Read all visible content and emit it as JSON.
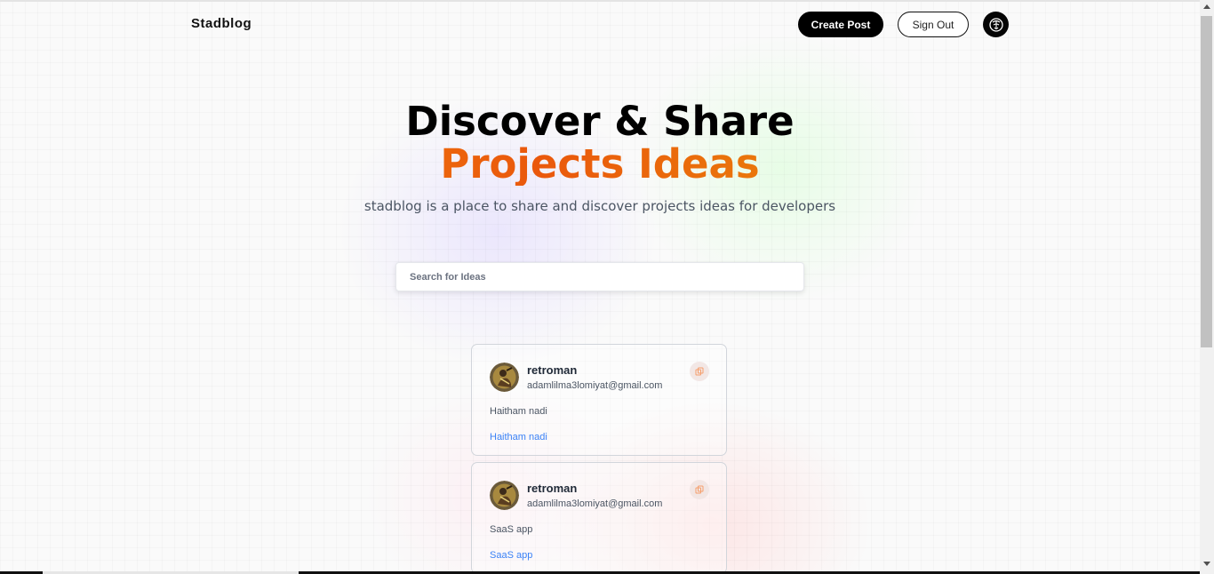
{
  "header": {
    "logo": "Stadblog",
    "create_post_label": "Create Post",
    "sign_out_label": "Sign Out"
  },
  "hero": {
    "title_line1": "Discover & Share",
    "title_line2": "Projects Ideas",
    "subtitle": "stadblog is a place to share and discover projects ideas for developers"
  },
  "search": {
    "placeholder": "Search for Ideas",
    "value": ""
  },
  "posts": [
    {
      "username": "retroman",
      "email": "adamlilma3lomiyat@gmail.com",
      "content": "Haitham nadi",
      "tag": "Haitham nadi"
    },
    {
      "username": "retroman",
      "email": "adamlilma3lomiyat@gmail.com",
      "content": "SaaS app",
      "tag": "SaaS app"
    }
  ],
  "icons": {
    "profile": "profile-avatar-icon",
    "copy": "copy-icon"
  },
  "colors": {
    "brand_gradient_start": "#f59e0b",
    "brand_gradient_mid": "#ea580c",
    "brand_gradient_end": "#eab308",
    "tag_blue": "#3b82f6",
    "primary_button": "#000000"
  }
}
